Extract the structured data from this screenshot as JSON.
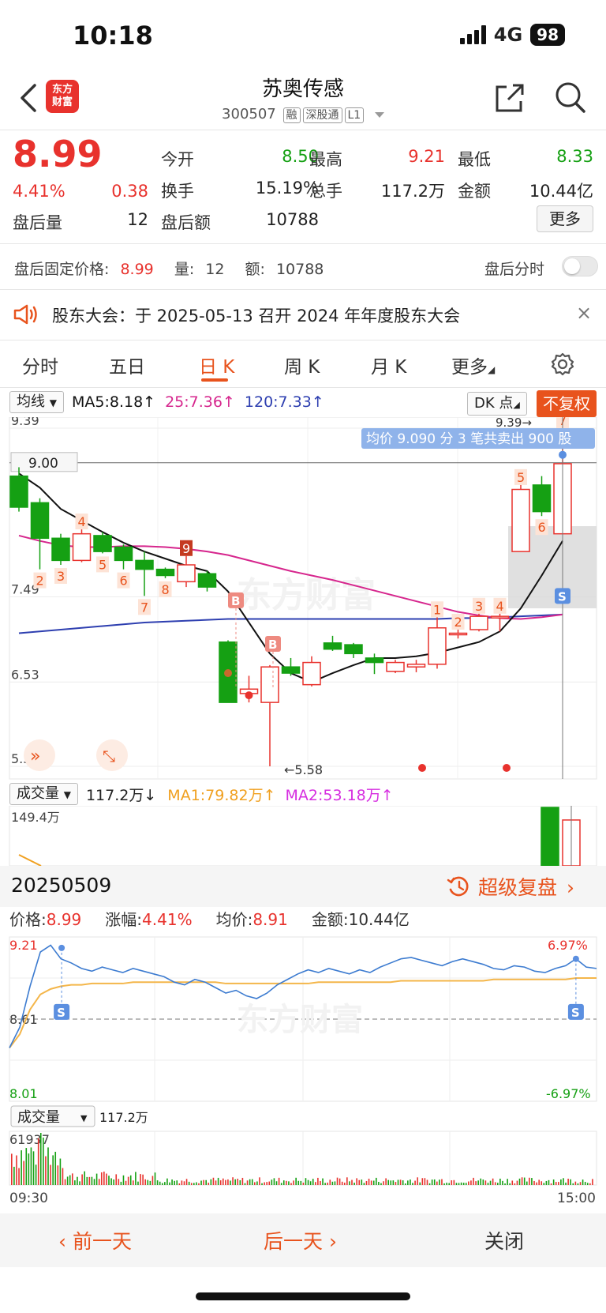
{
  "status": {
    "time": "10:18",
    "network": "4G",
    "battery": "98"
  },
  "header": {
    "title": "苏奥传感",
    "code": "300507",
    "tags": [
      "融",
      "深股通",
      "L1"
    ],
    "logo_text_line1": "东方",
    "logo_text_line2": "财富"
  },
  "quote": {
    "price": "8.99",
    "change_pct": "4.41%",
    "change": "0.38",
    "fields": [
      {
        "label": "今开",
        "value": "8.50",
        "color": "#15a013"
      },
      {
        "label": "最高",
        "value": "9.21",
        "color": "#e8322d"
      },
      {
        "label": "最低",
        "value": "8.33",
        "color": "#15a013"
      },
      {
        "label": "换手",
        "value": "15.19%",
        "color": "#222222"
      },
      {
        "label": "总手",
        "value": "117.2万",
        "color": "#222222"
      },
      {
        "label": "金额",
        "value": "10.44亿",
        "color": "#222222"
      }
    ],
    "after_vol_label": "盘后量",
    "after_vol": "12",
    "after_amt_label": "盘后额",
    "after_amt": "10788",
    "more_label": "更多"
  },
  "after_hours": {
    "price_label": "盘后固定价格:",
    "price": "8.99",
    "vol_label": "量:",
    "vol": "12",
    "amt_label": "额:",
    "amt": "10788",
    "toggle_label": "盘后分时"
  },
  "notice": {
    "text": "股东大会：于 2025-05-13 召开 2024 年年度股东大会",
    "close": "×"
  },
  "tabs": [
    "分时",
    "五日",
    "日 K",
    "周 K",
    "月 K",
    "更多"
  ],
  "indicators": {
    "ma_selector": "均线",
    "ma5": "MA5:8.18↑",
    "ma25": "25:7.36↑",
    "ma120": "120:7.33↑",
    "dk": "DK 点",
    "fq": "不复权",
    "vol_selector": "成交量",
    "vol_value": "117.2万↓",
    "vol_ma1": "MA1:79.82万↑",
    "vol_ma2": "MA2:53.18万↑",
    "colors": {
      "ma5": "#111111",
      "ma25": "#d6268d",
      "ma120": "#2e3fb0",
      "vol_ma1": "#f0a020",
      "vol_ma2": "#d62ee0"
    }
  },
  "kline": {
    "y_labels": [
      "9.39",
      "7.49",
      "6.53",
      "5.58"
    ],
    "y_ticks": [
      9.39,
      7.49,
      6.53,
      5.58
    ],
    "price_line": "9.00",
    "price_line_value": 9.0,
    "high_mark": "9.39→",
    "low_mark": "←5.58",
    "tooltip": "均价 9.090 分 3 笔共卖出 900 股",
    "candles": [
      {
        "o": 8.85,
        "c": 8.5,
        "h": 8.95,
        "l": 8.45,
        "n": ""
      },
      {
        "o": 8.55,
        "c": 8.15,
        "h": 8.6,
        "l": 7.8,
        "n": "2"
      },
      {
        "o": 8.15,
        "c": 7.9,
        "h": 8.2,
        "l": 7.85,
        "n": "3"
      },
      {
        "o": 7.9,
        "c": 8.2,
        "h": 8.25,
        "l": 7.88,
        "n": "4"
      },
      {
        "o": 8.18,
        "c": 8.0,
        "h": 8.22,
        "l": 7.98,
        "n": "5"
      },
      {
        "o": 8.05,
        "c": 7.9,
        "h": 8.08,
        "l": 7.8,
        "n": "6"
      },
      {
        "o": 7.9,
        "c": 7.8,
        "h": 8.0,
        "l": 7.5,
        "n": "7"
      },
      {
        "o": 7.8,
        "c": 7.73,
        "h": 7.82,
        "l": 7.7,
        "n": "8"
      },
      {
        "o": 7.66,
        "c": 7.85,
        "h": 7.95,
        "l": 7.6,
        "n": "9"
      },
      {
        "o": 7.75,
        "c": 7.6,
        "h": 7.78,
        "l": 7.55,
        "n": ""
      },
      {
        "o": 6.98,
        "c": 6.3,
        "h": 7.0,
        "l": 6.3,
        "n": ""
      },
      {
        "o": 6.4,
        "c": 6.45,
        "h": 6.6,
        "l": 6.3,
        "n": ""
      },
      {
        "o": 6.3,
        "c": 6.7,
        "h": 6.72,
        "l": 5.58,
        "n": ""
      },
      {
        "o": 6.7,
        "c": 6.63,
        "h": 6.8,
        "l": 6.6,
        "n": ""
      },
      {
        "o": 6.5,
        "c": 6.75,
        "h": 6.82,
        "l": 6.48,
        "n": ""
      },
      {
        "o": 6.97,
        "c": 6.9,
        "h": 7.05,
        "l": 6.88,
        "n": ""
      },
      {
        "o": 6.95,
        "c": 6.85,
        "h": 6.97,
        "l": 6.8,
        "n": ""
      },
      {
        "o": 6.8,
        "c": 6.75,
        "h": 6.85,
        "l": 6.62,
        "n": ""
      },
      {
        "o": 6.65,
        "c": 6.75,
        "h": 6.78,
        "l": 6.63,
        "n": ""
      },
      {
        "o": 6.7,
        "c": 6.73,
        "h": 6.78,
        "l": 6.64,
        "n": ""
      },
      {
        "o": 6.73,
        "c": 7.14,
        "h": 7.26,
        "l": 6.68,
        "n": "1"
      },
      {
        "o": 7.08,
        "c": 7.08,
        "h": 7.12,
        "l": 7.02,
        "n": "2"
      },
      {
        "o": 7.12,
        "c": 7.27,
        "h": 7.3,
        "l": 7.1,
        "n": "3"
      },
      {
        "o": 7.27,
        "c": 7.27,
        "h": 7.3,
        "l": 7.1,
        "n": "4"
      },
      {
        "o": 8.0,
        "c": 8.7,
        "h": 8.75,
        "l": 8.0,
        "n": "5"
      },
      {
        "o": 8.75,
        "c": 8.45,
        "h": 8.85,
        "l": 8.4,
        "n": "6"
      },
      {
        "o": 8.2,
        "c": 8.99,
        "h": 9.39,
        "l": 8.2,
        "n": "7"
      }
    ],
    "ma5": [
      8.88,
      8.72,
      8.48,
      8.35,
      8.22,
      8.1,
      8.0,
      7.92,
      7.84,
      7.78,
      7.55,
      7.2,
      6.85,
      6.63,
      6.53,
      6.63,
      6.72,
      6.8,
      6.8,
      6.82,
      6.86,
      6.92,
      6.98,
      7.1,
      7.36,
      7.73,
      8.12
    ],
    "ma25": [
      8.18,
      8.12,
      8.07,
      8.05,
      8.05,
      8.06,
      8.06,
      8.05,
      8.03,
      8.0,
      7.96,
      7.9,
      7.84,
      7.78,
      7.73,
      7.68,
      7.62,
      7.56,
      7.5,
      7.44,
      7.38,
      7.32,
      7.28,
      7.25,
      7.24,
      7.26,
      7.29
    ],
    "ma120": [
      7.08,
      7.1,
      7.12,
      7.14,
      7.16,
      7.18,
      7.2,
      7.21,
      7.22,
      7.23,
      7.24,
      7.24,
      7.24,
      7.24,
      7.24,
      7.24,
      7.24,
      7.24,
      7.24,
      7.24,
      7.24,
      7.25,
      7.25,
      7.26,
      7.27,
      7.28,
      7.29
    ],
    "b_marks": [
      "B",
      "B"
    ],
    "s_mark": "S"
  },
  "volume": {
    "y_label": "149.4万",
    "y_max": 149.4,
    "last_bars": [
      {
        "v": 149.4,
        "up": false
      },
      {
        "v": 117.2,
        "up": true
      }
    ]
  },
  "replay": {
    "date": "20250509",
    "label": "超级复盘",
    "stats": [
      {
        "k": "价格:",
        "v": "8.99"
      },
      {
        "k": "涨幅:",
        "v": "4.41%"
      },
      {
        "k": "均价:",
        "v": "8.91"
      },
      {
        "k": "金额:",
        "v": "10.44亿"
      }
    ]
  },
  "intraday": {
    "y_top": "9.21",
    "y_mid": "8.61",
    "y_bot": "8.01",
    "pct_top": "6.97%",
    "pct_bot": "-6.97%",
    "price_max": 9.21,
    "price_min": 8.01,
    "s_mark": "S",
    "vol_selector": "成交量",
    "vol_value": "117.2万",
    "vol_max_label": "61937",
    "vol_max": 61937,
    "time_start": "09:30",
    "time_end": "15:00",
    "price": [
      8.4,
      8.55,
      8.85,
      9.1,
      9.15,
      9.05,
      9.02,
      8.98,
      8.96,
      8.99,
      8.97,
      8.95,
      8.98,
      8.96,
      8.94,
      8.92,
      8.88,
      8.86,
      8.9,
      8.88,
      8.84,
      8.8,
      8.82,
      8.78,
      8.76,
      8.8,
      8.86,
      8.9,
      8.94,
      8.97,
      8.95,
      8.98,
      8.96,
      8.94,
      8.97,
      8.95,
      8.99,
      9.02,
      9.05,
      9.06,
      9.04,
      9.02,
      9.0,
      9.03,
      9.05,
      9.03,
      9.01,
      8.98,
      8.97,
      9.0,
      8.99,
      8.96,
      8.95,
      8.98,
      9.0,
      9.05,
      8.99,
      8.98
    ],
    "avg": [
      8.4,
      8.5,
      8.68,
      8.79,
      8.83,
      8.85,
      8.86,
      8.86,
      8.87,
      8.87,
      8.87,
      8.87,
      8.88,
      8.88,
      8.88,
      8.88,
      8.88,
      8.88,
      8.88,
      8.88,
      8.88,
      8.87,
      8.87,
      8.87,
      8.87,
      8.87,
      8.87,
      8.87,
      8.87,
      8.87,
      8.88,
      8.88,
      8.88,
      8.88,
      8.88,
      8.88,
      8.88,
      8.88,
      8.89,
      8.89,
      8.89,
      8.89,
      8.89,
      8.89,
      8.89,
      8.89,
      8.89,
      8.9,
      8.9,
      8.9,
      8.9,
      8.9,
      8.9,
      8.9,
      8.9,
      8.91,
      8.91,
      8.91
    ]
  },
  "bottom_nav": {
    "prev": "前一天",
    "next": "后一天",
    "close": "关闭"
  },
  "watermark": "东方财富"
}
